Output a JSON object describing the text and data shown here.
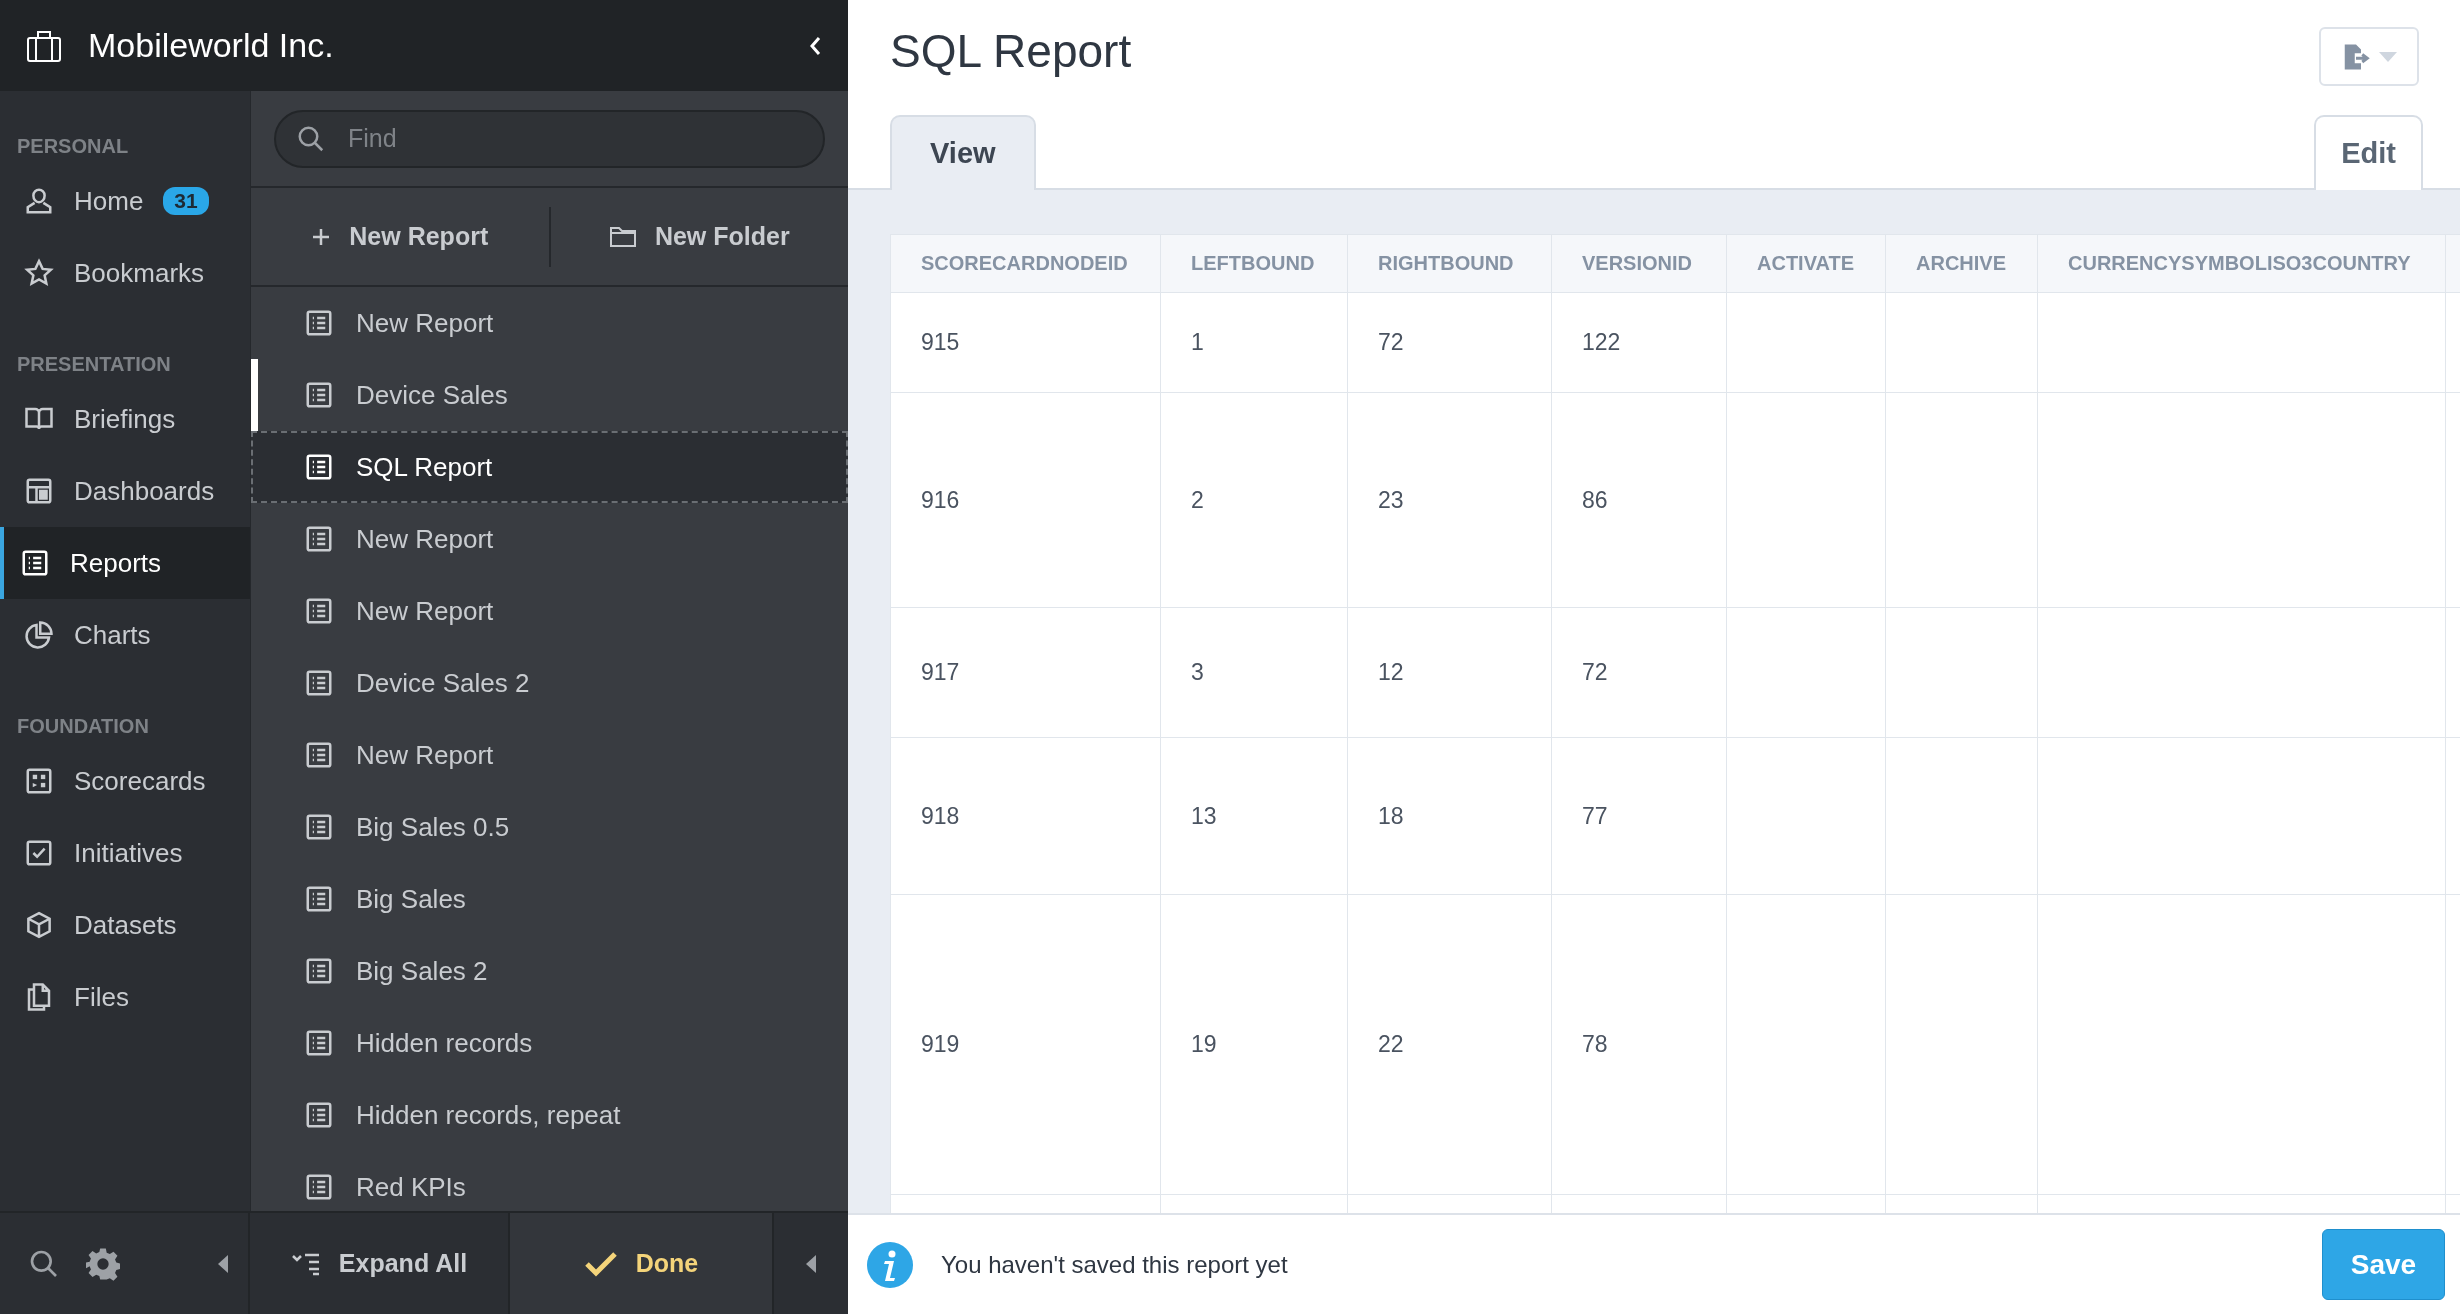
{
  "app": {
    "title": "Mobileworld Inc."
  },
  "nav": {
    "sections": [
      {
        "title": "PERSONAL",
        "items": [
          {
            "label": "Home",
            "badge": "31",
            "selected": false
          },
          {
            "label": "Bookmarks",
            "selected": false
          }
        ]
      },
      {
        "title": "PRESENTATION",
        "items": [
          {
            "label": "Briefings",
            "selected": false
          },
          {
            "label": "Dashboards",
            "selected": false
          },
          {
            "label": "Reports",
            "selected": true
          },
          {
            "label": "Charts",
            "selected": false
          }
        ]
      },
      {
        "title": "FOUNDATION",
        "items": [
          {
            "label": "Scorecards",
            "selected": false
          },
          {
            "label": "Initiatives",
            "selected": false
          },
          {
            "label": "Datasets",
            "selected": false
          },
          {
            "label": "Files",
            "selected": false
          }
        ]
      }
    ]
  },
  "report_list": {
    "search": {
      "placeholder": "Find"
    },
    "actions": [
      {
        "label": "New Report",
        "kind": "add"
      },
      {
        "label": "New Folder",
        "kind": "folder"
      }
    ],
    "items": [
      {
        "label": "New Report",
        "selected": false,
        "marked": false
      },
      {
        "label": "Device Sales",
        "selected": false,
        "marked": true
      },
      {
        "label": "SQL Report",
        "selected": true,
        "marked": false
      },
      {
        "label": "New Report",
        "selected": false,
        "marked": false
      },
      {
        "label": "New Report",
        "selected": false,
        "marked": false
      },
      {
        "label": "Device Sales 2",
        "selected": false,
        "marked": false
      },
      {
        "label": "New Report",
        "selected": false,
        "marked": false
      },
      {
        "label": "Big Sales 0.5",
        "selected": false,
        "marked": false
      },
      {
        "label": "Big Sales",
        "selected": false,
        "marked": false
      },
      {
        "label": "Big Sales 2",
        "selected": false,
        "marked": false
      },
      {
        "label": "Hidden records",
        "selected": false,
        "marked": false
      },
      {
        "label": "Hidden records, repeat",
        "selected": false,
        "marked": false
      },
      {
        "label": "Red KPIs",
        "selected": false,
        "marked": false
      }
    ],
    "footer": {
      "expand": "Expand All",
      "done": "Done"
    }
  },
  "report": {
    "title": "SQL Report",
    "tabs": [
      {
        "label": "View",
        "selected": true
      },
      {
        "label": "Edit",
        "selected": false
      }
    ],
    "table": {
      "columns": [
        "SCORECARDNODEID",
        "LEFTBOUND",
        "RIGHTBOUND",
        "VERSIONID",
        "ACTIVATE",
        "ARCHIVE",
        "CURRENCYSYMBOLISO3COUNTRY"
      ],
      "rows": [
        [
          "915",
          "1",
          "72",
          "122"
        ],
        [
          "916",
          "2",
          "23",
          "86"
        ],
        [
          "917",
          "3",
          "12",
          "72"
        ],
        [
          "918",
          "13",
          "18",
          "77"
        ],
        [
          "919",
          "19",
          "22",
          "78"
        ]
      ]
    },
    "notice": "You haven't saved this report yet",
    "save": "Save"
  }
}
